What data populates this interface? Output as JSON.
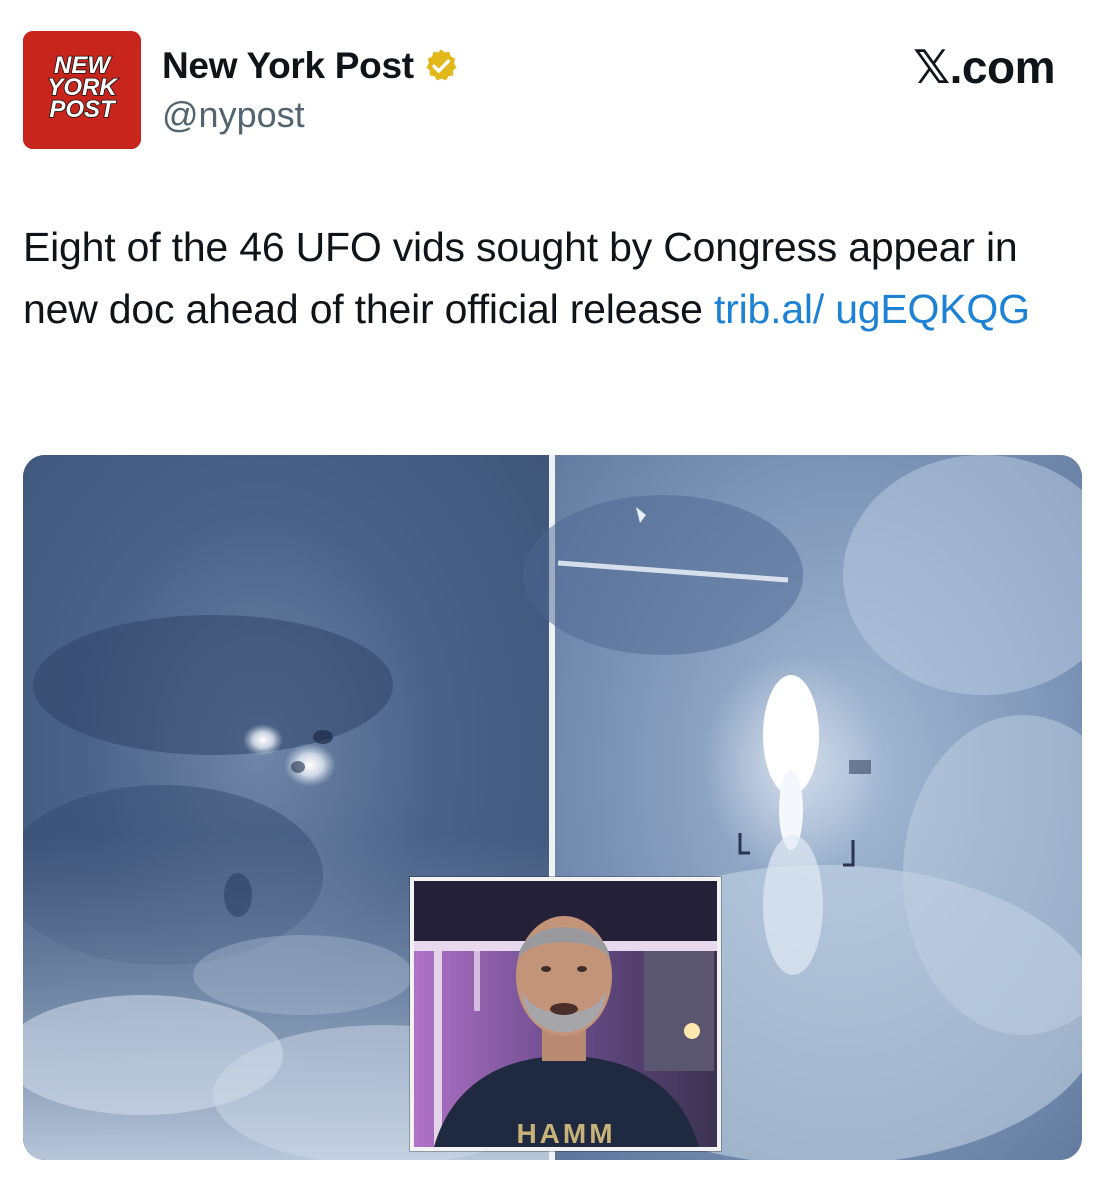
{
  "account": {
    "display_name": "New York Post",
    "handle": "@nypost",
    "logo_text": [
      "NEW",
      "YORK",
      "POST"
    ],
    "verified": true,
    "logo_icon": "nypost-logo-icon",
    "badge_icon": "verified-badge-icon",
    "logo_color": "#c8251d",
    "badge_color": "#e2b719"
  },
  "brand": {
    "site_label": "𝕏.com"
  },
  "tweet": {
    "text": "Eight of the 46 UFO vids sought by Congress appear in new doc ahead of their official release ",
    "link_text": "trib.al/ ugEQKQG",
    "link_color": "#1d82d4"
  },
  "media": {
    "panels": [
      "left-ufo-frame",
      "right-ufo-frame"
    ],
    "inset_icon": "interview-inset-photo",
    "shirt_text": "HAMM"
  }
}
